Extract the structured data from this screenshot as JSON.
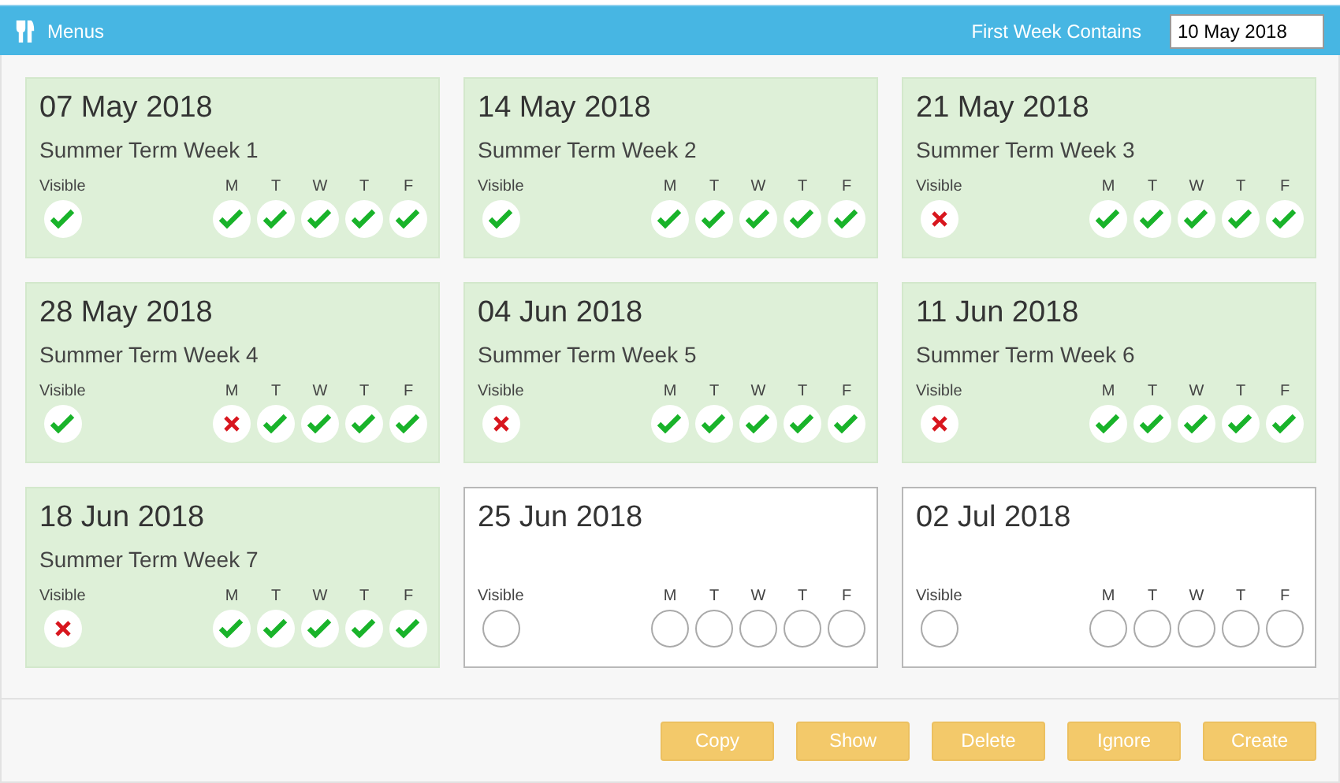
{
  "header": {
    "title": "Menus",
    "week_label": "First Week Contains",
    "week_value": "10 May 2018"
  },
  "weeks": [
    {
      "date": "07 May 2018",
      "name": "Summer Term Week 1",
      "configured": true,
      "visible": {
        "label": "Visible",
        "kind": "tick"
      },
      "days": [
        {
          "label": "M",
          "kind": "tick"
        },
        {
          "label": "T",
          "kind": "tick"
        },
        {
          "label": "W",
          "kind": "tick"
        },
        {
          "label": "T",
          "kind": "tick"
        },
        {
          "label": "F",
          "kind": "tick"
        }
      ]
    },
    {
      "date": "14 May 2018",
      "name": "Summer Term Week 2",
      "configured": true,
      "visible": {
        "label": "Visible",
        "kind": "tick"
      },
      "days": [
        {
          "label": "M",
          "kind": "tick"
        },
        {
          "label": "T",
          "kind": "tick"
        },
        {
          "label": "W",
          "kind": "tick"
        },
        {
          "label": "T",
          "kind": "tick"
        },
        {
          "label": "F",
          "kind": "tick"
        }
      ]
    },
    {
      "date": "21 May 2018",
      "name": "Summer Term Week 3",
      "configured": true,
      "visible": {
        "label": "Visible",
        "kind": "cross"
      },
      "days": [
        {
          "label": "M",
          "kind": "tick"
        },
        {
          "label": "T",
          "kind": "tick"
        },
        {
          "label": "W",
          "kind": "tick"
        },
        {
          "label": "T",
          "kind": "tick"
        },
        {
          "label": "F",
          "kind": "tick"
        }
      ]
    },
    {
      "date": "28 May 2018",
      "name": "Summer Term Week 4",
      "configured": true,
      "visible": {
        "label": "Visible",
        "kind": "tick"
      },
      "days": [
        {
          "label": "M",
          "kind": "cross"
        },
        {
          "label": "T",
          "kind": "tick"
        },
        {
          "label": "W",
          "kind": "tick"
        },
        {
          "label": "T",
          "kind": "tick"
        },
        {
          "label": "F",
          "kind": "tick"
        }
      ]
    },
    {
      "date": "04 Jun 2018",
      "name": "Summer Term Week 5",
      "configured": true,
      "visible": {
        "label": "Visible",
        "kind": "cross"
      },
      "days": [
        {
          "label": "M",
          "kind": "tick"
        },
        {
          "label": "T",
          "kind": "tick"
        },
        {
          "label": "W",
          "kind": "tick"
        },
        {
          "label": "T",
          "kind": "tick"
        },
        {
          "label": "F",
          "kind": "tick"
        }
      ]
    },
    {
      "date": "11 Jun 2018",
      "name": "Summer Term Week 6",
      "configured": true,
      "visible": {
        "label": "Visible",
        "kind": "cross"
      },
      "days": [
        {
          "label": "M",
          "kind": "tick"
        },
        {
          "label": "T",
          "kind": "tick"
        },
        {
          "label": "W",
          "kind": "tick"
        },
        {
          "label": "T",
          "kind": "tick"
        },
        {
          "label": "F",
          "kind": "tick"
        }
      ]
    },
    {
      "date": "18 Jun 2018",
      "name": "Summer Term Week 7",
      "configured": true,
      "visible": {
        "label": "Visible",
        "kind": "cross"
      },
      "days": [
        {
          "label": "M",
          "kind": "tick"
        },
        {
          "label": "T",
          "kind": "tick"
        },
        {
          "label": "W",
          "kind": "tick"
        },
        {
          "label": "T",
          "kind": "tick"
        },
        {
          "label": "F",
          "kind": "tick"
        }
      ]
    },
    {
      "date": "25 Jun 2018",
      "configured": false,
      "visible": {
        "label": "Visible",
        "kind": "empty"
      },
      "days": [
        {
          "label": "M",
          "kind": "empty"
        },
        {
          "label": "T",
          "kind": "empty"
        },
        {
          "label": "W",
          "kind": "empty"
        },
        {
          "label": "T",
          "kind": "empty"
        },
        {
          "label": "F",
          "kind": "empty"
        }
      ]
    },
    {
      "date": "02 Jul 2018",
      "configured": false,
      "visible": {
        "label": "Visible",
        "kind": "empty"
      },
      "days": [
        {
          "label": "M",
          "kind": "empty"
        },
        {
          "label": "T",
          "kind": "empty"
        },
        {
          "label": "W",
          "kind": "empty"
        },
        {
          "label": "T",
          "kind": "empty"
        },
        {
          "label": "F",
          "kind": "empty"
        }
      ]
    }
  ],
  "buttons": [
    "Copy",
    "Show",
    "Delete",
    "Ignore",
    "Create"
  ]
}
